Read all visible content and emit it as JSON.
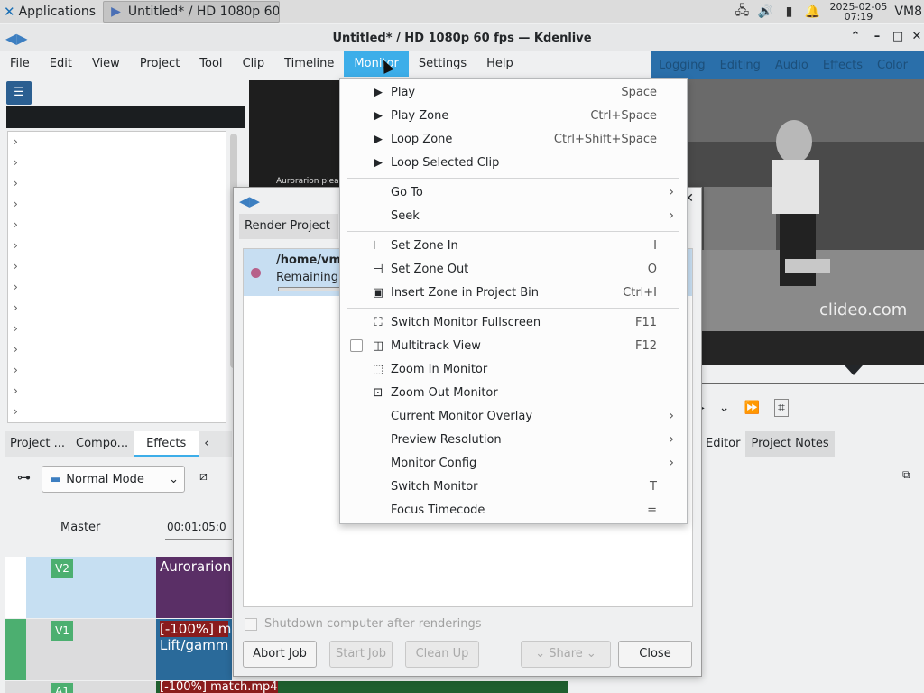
{
  "taskbar": {
    "apps_label": "Applications",
    "task_label": "Untitled* / HD 1080p 60...",
    "clock_date": "2025-02-05",
    "clock_time": "07:19",
    "vm_label": "VM8"
  },
  "window": {
    "title": "Untitled* / HD 1080p 60 fps — Kdenlive"
  },
  "menubar": {
    "items": [
      "File",
      "Edit",
      "View",
      "Project",
      "Tool",
      "Clip",
      "Timeline",
      "Monitor",
      "Settings",
      "Help"
    ],
    "active": "Monitor"
  },
  "layouts": [
    "Logging",
    "Editing",
    "Audio",
    "Effects",
    "Color"
  ],
  "bottom_tabs": [
    "Project ...",
    "Compo...",
    "Effects"
  ],
  "mixer": {
    "mode": "Normal Mode",
    "master_label": "Master",
    "timecode": "00:01:05:0"
  },
  "tracks": {
    "v2": "V2",
    "v1": "V1",
    "a1": "A1",
    "clip_v2": "Aurorarion",
    "clip_v1_line1": "[-100%] m",
    "clip_v1_line2": "Lift/gamm",
    "clip_a1": "[-100%] match.mp4"
  },
  "monitor": {
    "caption": "Aurorarion plea",
    "watermark": "clideo.com"
  },
  "right_tabs": [
    "Editor",
    "Project Notes"
  ],
  "render_dialog": {
    "tab": "Render Project",
    "job_path": "/home/vm",
    "job_status": "Remaining",
    "shutdown_label": "Shutdown computer after renderings",
    "abort": "Abort Job",
    "start": "Start Job",
    "cleanup": "Clean Up",
    "share": "Share",
    "close": "Close"
  },
  "monitor_menu": {
    "play": {
      "label": "Play",
      "shortcut": "Space"
    },
    "play_zone": {
      "label": "Play Zone",
      "shortcut": "Ctrl+Space"
    },
    "loop_zone": {
      "label": "Loop Zone",
      "shortcut": "Ctrl+Shift+Space"
    },
    "loop_selected": {
      "label": "Loop Selected Clip",
      "shortcut": ""
    },
    "go_to": {
      "label": "Go To"
    },
    "seek": {
      "label": "Seek"
    },
    "set_zone_in": {
      "label": "Set Zone In",
      "shortcut": "I"
    },
    "set_zone_out": {
      "label": "Set Zone Out",
      "shortcut": "O"
    },
    "insert_zone": {
      "label": "Insert Zone in Project Bin",
      "shortcut": "Ctrl+I"
    },
    "fullscreen": {
      "label": "Switch Monitor Fullscreen",
      "shortcut": "F11"
    },
    "multitrack": {
      "label": "Multitrack View",
      "shortcut": "F12"
    },
    "zoom_in": {
      "label": "Zoom In Monitor",
      "shortcut": ""
    },
    "zoom_out": {
      "label": "Zoom Out Monitor",
      "shortcut": ""
    },
    "overlay": {
      "label": "Current Monitor Overlay"
    },
    "preview_res": {
      "label": "Preview Resolution"
    },
    "monitor_config": {
      "label": "Monitor Config"
    },
    "switch_monitor": {
      "label": "Switch Monitor",
      "shortcut": "T"
    },
    "focus_timecode": {
      "label": "Focus Timecode",
      "shortcut": "="
    }
  }
}
